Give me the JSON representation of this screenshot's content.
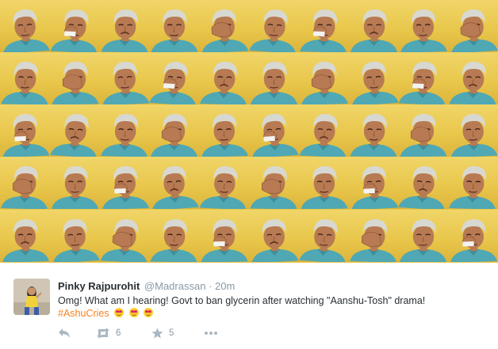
{
  "tweet": {
    "display_name": "Pinky Rajpurohit",
    "username": "@Madrassan",
    "separator": "·",
    "timestamp": "20m",
    "text": "Omg! What am I hearing! Govt to ban glycerin after watching \"Aanshu-Tosh\" drama!",
    "hashtag": "#AshuCries",
    "emojis": [
      "heart-eyes-emoji",
      "heart-eyes-emoji",
      "heart-eyes-emoji"
    ],
    "actions": {
      "reply": {
        "icon": "reply-icon"
      },
      "retweet": {
        "icon": "retweet-icon",
        "count": "6"
      },
      "favorite": {
        "icon": "star-icon",
        "count": "5"
      },
      "more": {
        "icon": "more-icon"
      }
    }
  },
  "colors": {
    "collage_background": "#e9c84a",
    "shirt": "#4fa8b4",
    "hair": "#d8d8d2",
    "skin": "#b77a52",
    "hashtag": "#f5821f",
    "name": "#292f33",
    "meta": "#8899a6"
  }
}
